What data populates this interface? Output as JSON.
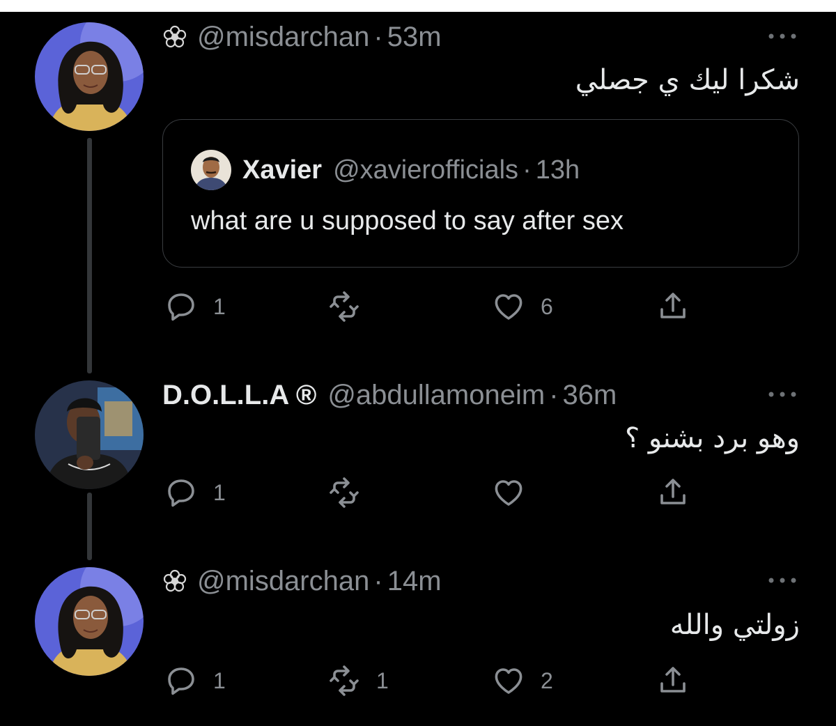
{
  "tweets": [
    {
      "handle": "@misdarchan",
      "separator": "·",
      "time": "53m",
      "text": "شكرا ليك ي جصلي",
      "quote": {
        "name": "Xavier",
        "handle": "@xavierofficials",
        "separator": "·",
        "time": "13h",
        "text": "what are u supposed to say after sex"
      },
      "actions": {
        "replies": "1",
        "retweets": "",
        "likes": "6"
      }
    },
    {
      "name": "D.O.L.L.A ®",
      "handle": "@abdullamoneim",
      "separator": "·",
      "time": "36m",
      "text": "وهو برد بشنو ؟",
      "actions": {
        "replies": "1",
        "retweets": "",
        "likes": ""
      }
    },
    {
      "handle": "@misdarchan",
      "separator": "·",
      "time": "14m",
      "text": "زولتي والله",
      "actions": {
        "replies": "1",
        "retweets": "1",
        "likes": "2"
      }
    }
  ],
  "icons": {
    "flower": "flower-emoji-icon",
    "more": "more-icon",
    "reply": "reply-icon",
    "retweet": "retweet-icon",
    "like": "heart-icon",
    "share": "share-icon"
  },
  "colors": {
    "background": "#000000",
    "text": "#e7e9ea",
    "secondary": "#8b8f94",
    "border": "#3a3d41"
  }
}
